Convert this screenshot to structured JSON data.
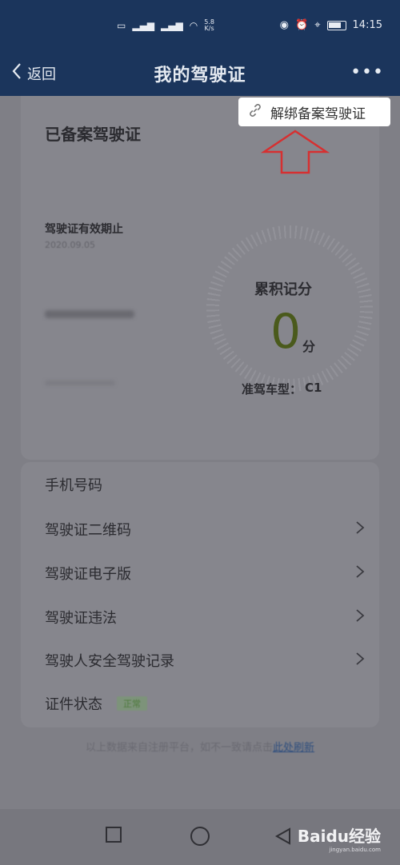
{
  "status_bar": {
    "speed_value": "5.8",
    "speed_unit": "K/s",
    "time": "14:15"
  },
  "header": {
    "back_label": "返回",
    "title": "我的驾驶证",
    "more_label": "•••"
  },
  "popup": {
    "unbind_label": "解绑备案驾驶证"
  },
  "card": {
    "title": "已备案驾驶证",
    "expiry_label": "驾驶证有效期止",
    "expiry_value": "2020.09.05",
    "points_label": "累积记分",
    "points_value": "0",
    "points_unit": "分",
    "class_label": "准驾车型：",
    "class_value": "C1"
  },
  "list": {
    "items": [
      {
        "label": "手机号码"
      },
      {
        "label": "驾驶证二维码"
      },
      {
        "label": "驾驶证电子版"
      },
      {
        "label": "驾驶证违法"
      },
      {
        "label": "驾驶人安全驾驶记录"
      },
      {
        "label": "证件状态",
        "badge": "正常"
      }
    ]
  },
  "footer": {
    "text": "以上数据来自注册平台，如不一致请点击",
    "link": "此处刷新"
  },
  "watermark": {
    "brand": "Baidu经验",
    "url": "jingyan.baidu.com"
  }
}
